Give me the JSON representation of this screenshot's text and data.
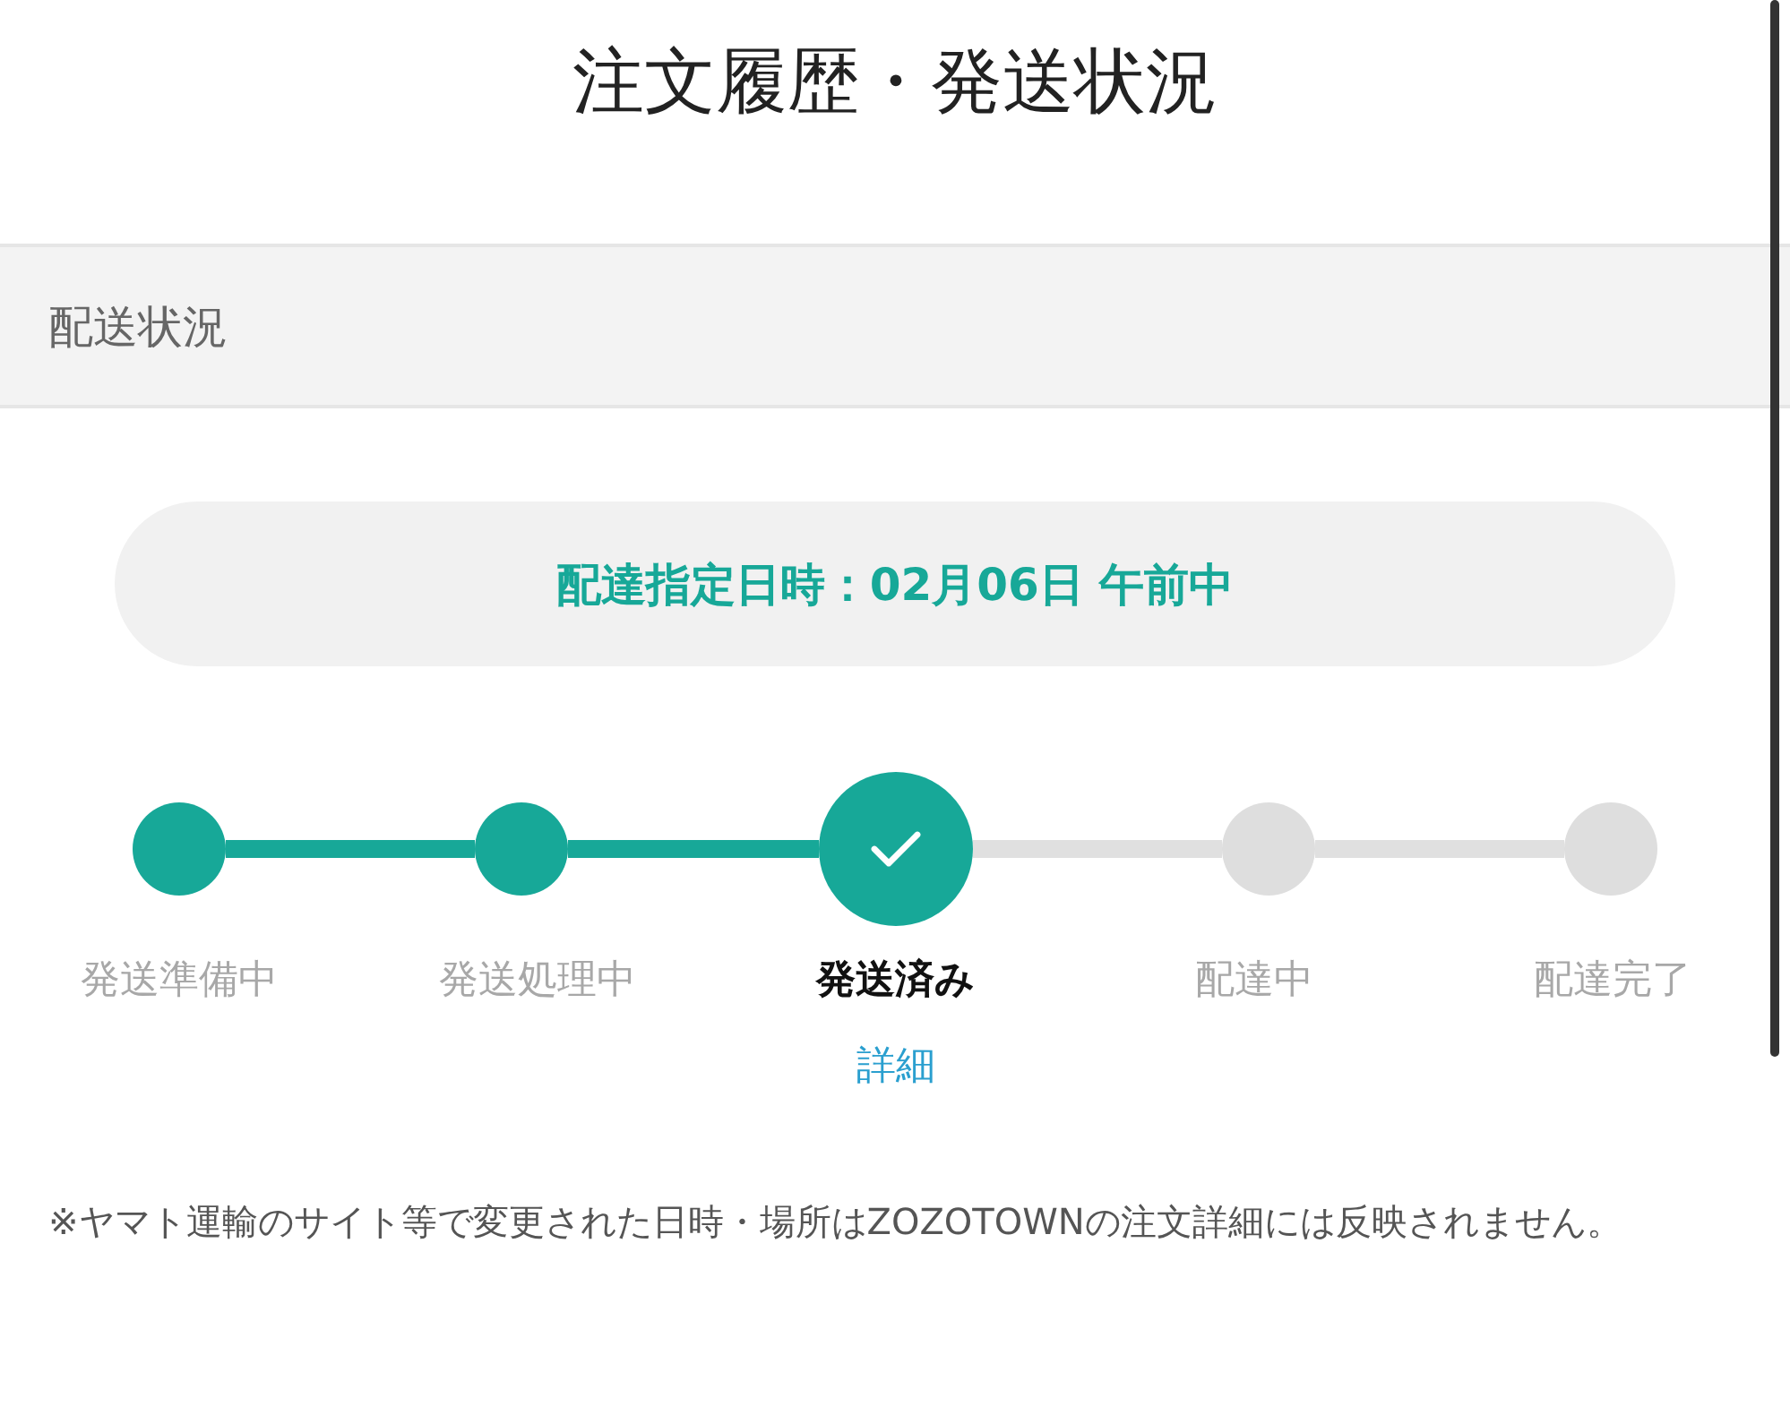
{
  "title": "注文履歴・発送状況",
  "section": {
    "heading": "配送状況"
  },
  "delivery": {
    "text": "配達指定日時：02月06日 午前中"
  },
  "steps": [
    {
      "label": "発送準備中",
      "done": true,
      "selected": false
    },
    {
      "label": "発送処理中",
      "done": true,
      "selected": false
    },
    {
      "label": "発送済み",
      "done": true,
      "selected": true
    },
    {
      "label": "配達中",
      "done": false,
      "selected": false
    },
    {
      "label": "配達完了",
      "done": false,
      "selected": false
    }
  ],
  "detail_link": "詳細",
  "note": "※ヤマト運輸のサイト等で変更された日時・場所はZOZOTOWNの注文詳細には反映されません。"
}
